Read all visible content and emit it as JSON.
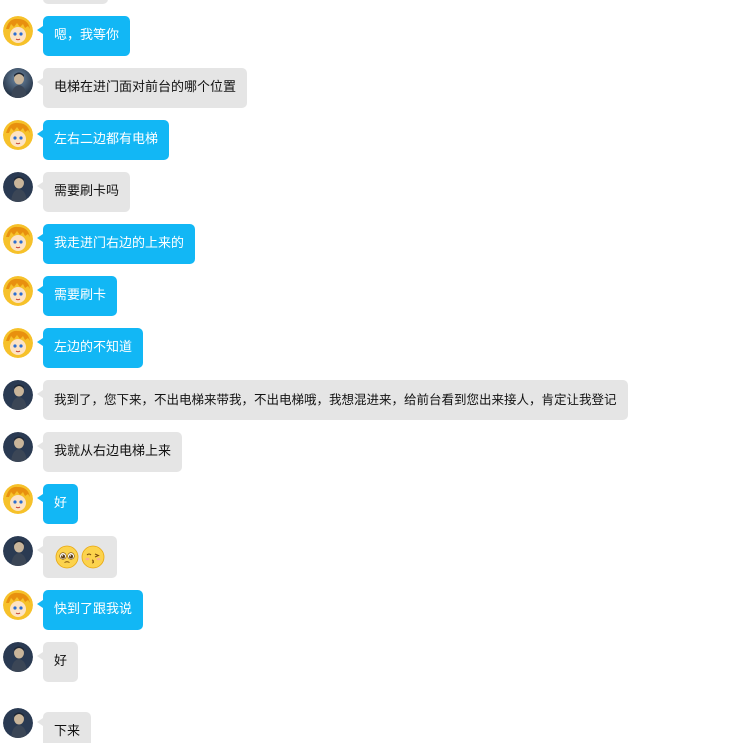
{
  "colors": {
    "self_bubble": "#12b7f5",
    "other_bubble": "#e5e5e5",
    "self_text": "#ffffff",
    "other_text": "#111111"
  },
  "messages": [
    {
      "sender": "me",
      "text": "嗯，我等你"
    },
    {
      "sender": "other",
      "text": "电梯在进门面对前台的哪个位置"
    },
    {
      "sender": "me",
      "text": "左右二边都有电梯"
    },
    {
      "sender": "other",
      "text": "需要刷卡吗"
    },
    {
      "sender": "me",
      "text": "我走进门右边的上来的"
    },
    {
      "sender": "me",
      "text": "需要刷卡"
    },
    {
      "sender": "me",
      "text": "左边的不知道"
    },
    {
      "sender": "other",
      "text": "我到了，您下来，不出电梯来带我，不出电梯哦，我想混进来，给前台看到您出来接人，肯定让我登记"
    },
    {
      "sender": "other",
      "text": "我就从右边电梯上来"
    },
    {
      "sender": "me",
      "text": "好"
    },
    {
      "sender": "other",
      "emoji": [
        "pleading-face-emoji",
        "kissing-face-emoji"
      ]
    },
    {
      "sender": "me",
      "text": "快到了跟我说"
    },
    {
      "sender": "other",
      "text": "好"
    },
    {
      "sender": "other",
      "text": "下来"
    }
  ]
}
